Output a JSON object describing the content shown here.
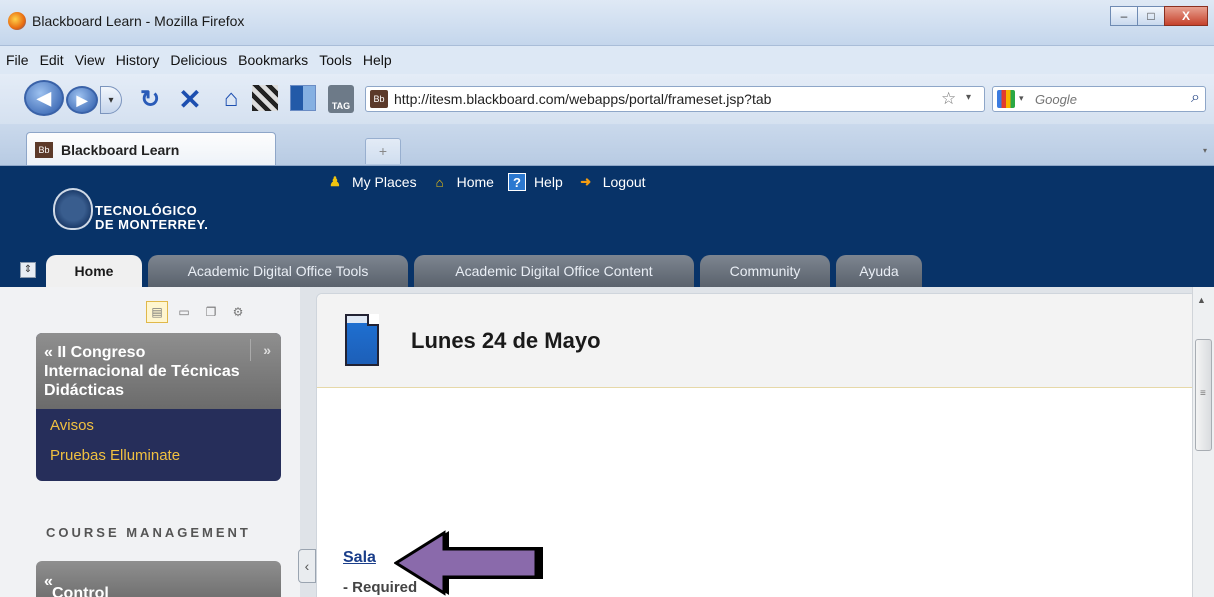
{
  "window": {
    "title": "Blackboard Learn - Mozilla Firefox",
    "min": "–",
    "max": "□",
    "close": "X"
  },
  "menu": [
    "File",
    "Edit",
    "View",
    "History",
    "Delicious",
    "Bookmarks",
    "Tools",
    "Help"
  ],
  "nav": {
    "url": "http://itesm.blackboard.com/webapps/portal/frameset.jsp?tab",
    "search_placeholder": "Google",
    "tag_label": "TAG",
    "favicon_label": "Bb"
  },
  "browser_tabs": [
    {
      "label": "Blackboard Learn",
      "favicon": "Bb"
    }
  ],
  "new_tab": "+",
  "logo": {
    "line1": "TECNOLÓGICO",
    "line2": "DE MONTERREY."
  },
  "top_links": [
    "My Places",
    "Home",
    "Help",
    "Logout"
  ],
  "bb_tabs": [
    "Home",
    "Academic Digital Office Tools",
    "Academic Digital Office Content",
    "Community",
    "Ayuda"
  ],
  "sidebar": {
    "course_title": "II Congreso Internacional de Técnicas Didácticas",
    "course_links": [
      "Avisos",
      "Pruebas Elluminate"
    ],
    "section_label": "COURSE MANAGEMENT",
    "control_panel": "Control Panel"
  },
  "main": {
    "title": "Lunes 24 de Mayo",
    "link": "Sala",
    "required_text": "- Required"
  },
  "colors": {
    "header": "#083368",
    "arrow": "#8a6aab",
    "link": "#1a3e8a"
  }
}
